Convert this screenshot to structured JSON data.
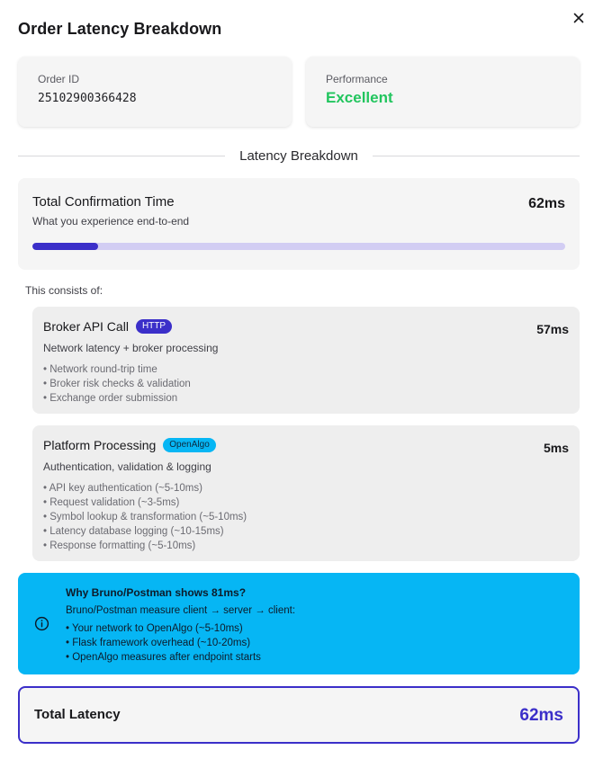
{
  "modal": {
    "title": "Order Latency Breakdown"
  },
  "order": {
    "label": "Order ID",
    "value": "25102900366428"
  },
  "performance": {
    "label": "Performance",
    "value": "Excellent",
    "color": "#22c55e"
  },
  "divider_label": "Latency Breakdown",
  "total": {
    "title": "Total Confirmation Time",
    "subtitle": "What you experience end-to-end",
    "value": "62ms",
    "progress_fraction": 0.123
  },
  "consists_label": "This consists of:",
  "components": [
    {
      "title": "Broker API Call",
      "badge": "HTTP",
      "value": "57ms",
      "description": "Network latency + broker processing",
      "items": [
        "• Network round-trip time",
        "• Broker risk checks & validation",
        "• Exchange order submission"
      ]
    },
    {
      "title": "Platform Processing",
      "badge": "OpenAlgo",
      "value": "5ms",
      "description": "Authentication, validation & logging",
      "items": [
        "• API key authentication (~5-10ms)",
        "• Request validation (~3-5ms)",
        "• Symbol lookup & transformation (~5-10ms)",
        "• Latency database logging (~10-15ms)",
        "• Response formatting (~5-10ms)"
      ]
    }
  ],
  "why": {
    "icon": "info-icon",
    "title": "Why Bruno/Postman shows 81ms?",
    "subtitle": "Bruno/Postman measure client → server → client:",
    "items": [
      "• Your network to OpenAlgo (~5-10ms)",
      "• Flask framework overhead (~10-20ms)",
      "• OpenAlgo measures after endpoint starts"
    ]
  },
  "total_latency": {
    "label": "Total Latency",
    "value": "62ms"
  },
  "colors": {
    "accent": "#3b2fc9",
    "info": "#06b6f4",
    "success": "#22c55e"
  }
}
